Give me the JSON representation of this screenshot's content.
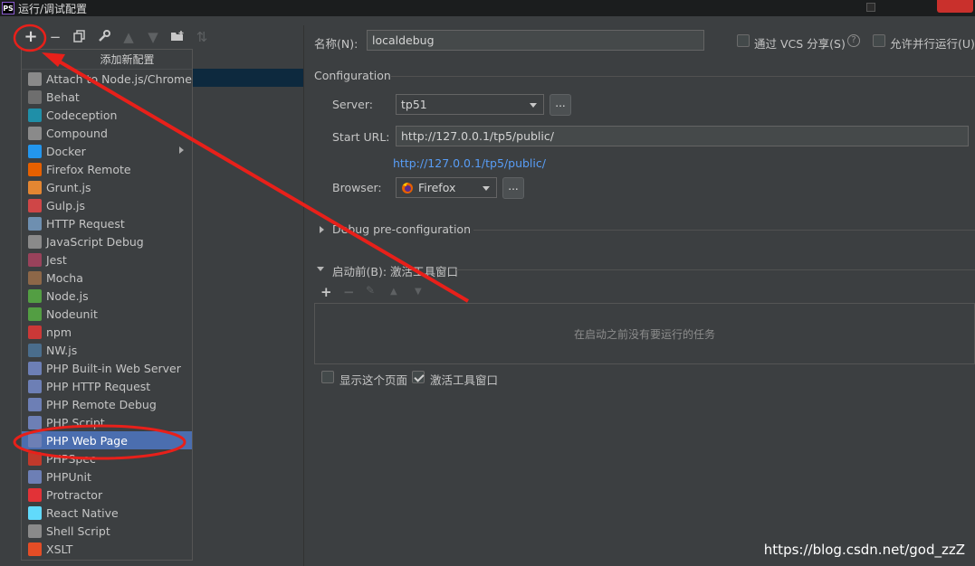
{
  "window": {
    "title": "运行/调试配置",
    "app_icon": "PS"
  },
  "toolbar": {
    "add_tooltip": "添加新配置",
    "buttons": [
      "plus-icon",
      "minus-icon",
      "copy-icon",
      "wrench-icon",
      "arrow-up-icon",
      "arrow-down-icon",
      "folder-plus-icon",
      "sort-icon"
    ]
  },
  "menu": {
    "items": [
      {
        "label": "Attach to Node.js/Chrome",
        "icon": "attach-js-icon",
        "color": "#8a8a8a"
      },
      {
        "label": "Behat",
        "icon": "behat-icon",
        "color": "#6e6e6e"
      },
      {
        "label": "Codeception",
        "icon": "codeception-icon",
        "color": "#1f8fa8"
      },
      {
        "label": "Compound",
        "icon": "compound-icon",
        "color": "#8a8a8a"
      },
      {
        "label": "Docker",
        "icon": "docker-icon",
        "color": "#2396ed"
      },
      {
        "label": "Firefox Remote",
        "icon": "firefox-icon",
        "color": "#e66000"
      },
      {
        "label": "Grunt.js",
        "icon": "grunt-icon",
        "color": "#e48632"
      },
      {
        "label": "Gulp.js",
        "icon": "gulp-icon",
        "color": "#cf4647"
      },
      {
        "label": "HTTP Request",
        "icon": "api-icon",
        "color": "#6e8fb0"
      },
      {
        "label": "JavaScript Debug",
        "icon": "js-debug-icon",
        "color": "#8a8a8a"
      },
      {
        "label": "Jest",
        "icon": "jest-icon",
        "color": "#99425b"
      },
      {
        "label": "Mocha",
        "icon": "mocha-icon",
        "color": "#8d6748"
      },
      {
        "label": "Node.js",
        "icon": "nodejs-icon",
        "color": "#539e43"
      },
      {
        "label": "Nodeunit",
        "icon": "nodeunit-icon",
        "color": "#539e43"
      },
      {
        "label": "npm",
        "icon": "npm-icon",
        "color": "#cb3837"
      },
      {
        "label": "NW.js",
        "icon": "nwjs-icon",
        "color": "#4a6d8c"
      },
      {
        "label": "PHP Built-in Web Server",
        "icon": "php-icon",
        "color": "#6d7fb5"
      },
      {
        "label": "PHP HTTP Request",
        "icon": "php-icon",
        "color": "#6d7fb5"
      },
      {
        "label": "PHP Remote Debug",
        "icon": "php-icon",
        "color": "#6d7fb5"
      },
      {
        "label": "PHP Script",
        "icon": "php-icon",
        "color": "#6d7fb5"
      },
      {
        "label": "PHP Web Page",
        "icon": "php-icon",
        "color": "#6d7fb5",
        "selected": true
      },
      {
        "label": "PHPSpec",
        "icon": "phpspec-icon",
        "color": "#c0392b"
      },
      {
        "label": "PHPUnit",
        "icon": "phpunit-icon",
        "color": "#6d7fb5"
      },
      {
        "label": "Protractor",
        "icon": "protractor-icon",
        "color": "#e23237"
      },
      {
        "label": "React Native",
        "icon": "react-icon",
        "color": "#61dafb"
      },
      {
        "label": "Shell Script",
        "icon": "shell-icon",
        "color": "#8a8a8a"
      },
      {
        "label": "XSLT",
        "icon": "xslt-icon",
        "color": "#e44d26"
      }
    ]
  },
  "form": {
    "name_label": "名称(N):",
    "name_value": "localdebug",
    "vcs_share_label": "通过 VCS 分享(S)",
    "parallel_label": "允许并行运行(U)",
    "section_title": "Configuration",
    "server_label": "Server:",
    "server_value": "tp51",
    "start_url_label": "Start URL:",
    "start_url_value": "http://127.0.0.1/tp5/public/",
    "start_url_link": "http://127.0.0.1/tp5/public/",
    "browser_label": "Browser:",
    "browser_value": "Firefox",
    "dots_label": "...",
    "debug_preconfig_label": "Debug pre-configuration",
    "before_launch_label": "启动前(B): 激活工具窗口",
    "no_tasks_text": "在启动之前没有要运行的任务",
    "show_page_label": "显示这个页面",
    "activate_window_label": "激活工具窗口",
    "show_page_checked": false,
    "activate_window_checked": true
  },
  "watermark": "https://blog.csdn.net/god_zzZ",
  "annotation_color": "#e8201a"
}
